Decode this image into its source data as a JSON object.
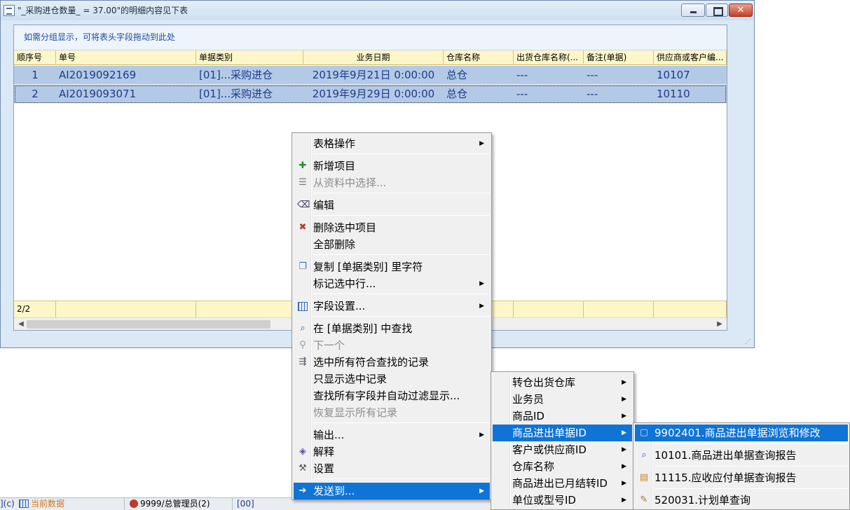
{
  "window": {
    "title": "\"_采购进仓数量_ = 37.00\"的明细内容见下表"
  },
  "grid": {
    "group_hint": "如需分组显示，可将表头字段拖动到此处",
    "columns": [
      "顺序号",
      "单号",
      "单据类别",
      "业务日期",
      "仓库名称",
      "出货仓库名称(...",
      "备注(单据)",
      "供应商或客户编..."
    ],
    "rows": [
      {
        "seq": "1",
        "doc_no": "AI2019092169",
        "type": "[01]...采购进仓",
        "date": "2019年9月21日 0:00:00",
        "warehouse": "总仓",
        "out_warehouse": "---",
        "remark": "---",
        "supplier": "10107"
      },
      {
        "seq": "2",
        "doc_no": "AI2019093071",
        "type": "[01]...采购进仓",
        "date": "2019年9月29日 0:00:00",
        "warehouse": "总仓",
        "out_warehouse": "---",
        "remark": "---",
        "supplier": "10110"
      }
    ],
    "footer_count": "2/2"
  },
  "statusbar": {
    "left_fragment": "](c)",
    "current_data": "当前数据",
    "user": "9999/总管理员(2)",
    "code": "[00]"
  },
  "context_menu": {
    "items": {
      "table_ops": "表格操作",
      "add_item": "新增项目",
      "select_from_data": "从资料中选择...",
      "edit": "编辑",
      "delete_selected": "删除选中项目",
      "delete_all": "全部删除",
      "copy_field": "复制 [单据类别] 里字符",
      "mark_selected": "标记选中行...",
      "field_settings": "字段设置...",
      "find_in_field": "在 [单据类别] 中查找",
      "next": "下一个",
      "select_all_matches": "选中所有符合查找的记录",
      "show_selected_only": "只显示选中记录",
      "find_all_filter": "查找所有字段并自动过滤显示...",
      "restore_all": "恢复显示所有记录",
      "output": "输出...",
      "explain": "解释",
      "settings": "设置",
      "send_to": "发送到..."
    }
  },
  "send_to_menu": {
    "items": [
      "转仓出货仓库",
      "业务员",
      "商品ID",
      "商品进出单据ID",
      "客户或供应商ID",
      "仓库名称",
      "商品进出已月结转ID",
      "单位或型号ID"
    ]
  },
  "doc_id_menu": {
    "items": [
      "9902401.商品进出单据浏览和修改",
      "10101.商品进出单据查询报告",
      "11115.应收应付单据查询报告",
      "520031.计划单查询"
    ]
  }
}
